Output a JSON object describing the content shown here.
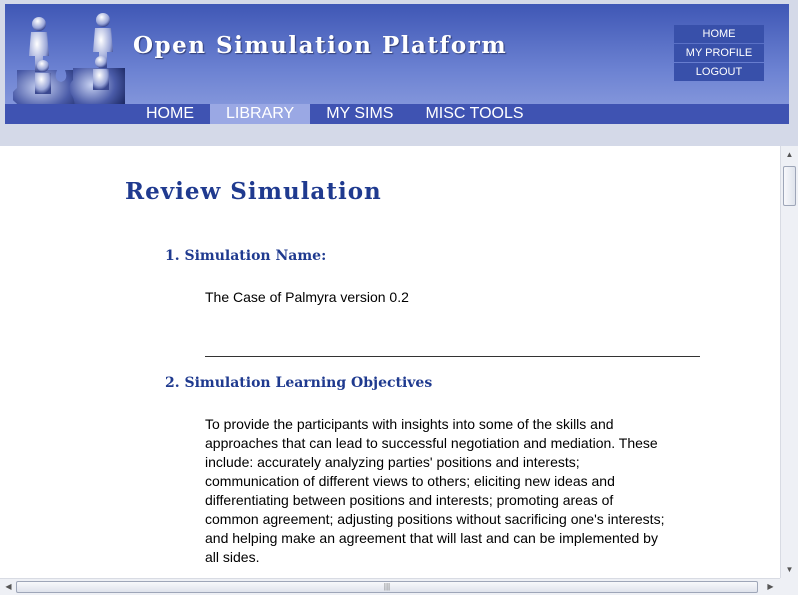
{
  "header": {
    "site_title": "Open Simulation Platform",
    "user_menu": [
      "HOME",
      "MY PROFILE",
      "LOGOUT"
    ],
    "nav": [
      {
        "label": "HOME",
        "active": false
      },
      {
        "label": "LIBRARY",
        "active": true
      },
      {
        "label": "MY SIMS",
        "active": false
      },
      {
        "label": "MISC TOOLS",
        "active": false
      }
    ]
  },
  "main": {
    "page_title": "Review Simulation",
    "sections": [
      {
        "heading": "1. Simulation Name:",
        "text": "The Case of Palmyra version 0.2"
      },
      {
        "heading": "2. Simulation Learning Objectives",
        "text": "To provide the participants with insights into some of the skills and approaches that can lead to successful negotiation and mediation. These include: accurately analyzing parties' positions and interests; communication of different views to others; eliciting new ideas and differentiating between positions and interests; promoting areas of common agreement; adjusting positions without sacrificing one's interests; and helping make an agreement that will last and can be implemented by all sides."
      }
    ]
  },
  "colors": {
    "banner": "#4a62c0",
    "nav_active": "#9aa8e4",
    "heading": "#1f3a8f"
  },
  "icons": {
    "logo": "puzzle-people-logo",
    "scroll_up": "arrow-up-icon",
    "scroll_down": "arrow-down-icon",
    "scroll_left": "arrow-left-icon",
    "scroll_right": "arrow-right-icon"
  }
}
